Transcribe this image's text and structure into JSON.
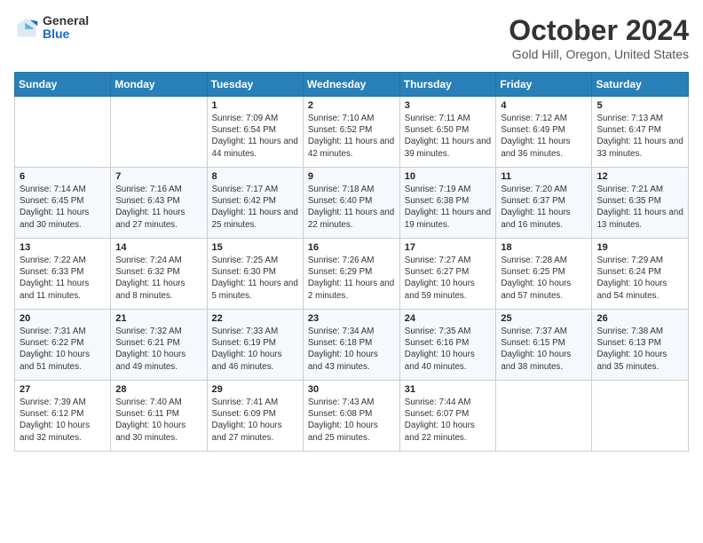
{
  "logo": {
    "general": "General",
    "blue": "Blue"
  },
  "title": "October 2024",
  "subtitle": "Gold Hill, Oregon, United States",
  "days_of_week": [
    "Sunday",
    "Monday",
    "Tuesday",
    "Wednesday",
    "Thursday",
    "Friday",
    "Saturday"
  ],
  "weeks": [
    [
      {
        "day": "",
        "info": ""
      },
      {
        "day": "",
        "info": ""
      },
      {
        "day": "1",
        "info": "Sunrise: 7:09 AM\nSunset: 6:54 PM\nDaylight: 11 hours and 44 minutes."
      },
      {
        "day": "2",
        "info": "Sunrise: 7:10 AM\nSunset: 6:52 PM\nDaylight: 11 hours and 42 minutes."
      },
      {
        "day": "3",
        "info": "Sunrise: 7:11 AM\nSunset: 6:50 PM\nDaylight: 11 hours and 39 minutes."
      },
      {
        "day": "4",
        "info": "Sunrise: 7:12 AM\nSunset: 6:49 PM\nDaylight: 11 hours and 36 minutes."
      },
      {
        "day": "5",
        "info": "Sunrise: 7:13 AM\nSunset: 6:47 PM\nDaylight: 11 hours and 33 minutes."
      }
    ],
    [
      {
        "day": "6",
        "info": "Sunrise: 7:14 AM\nSunset: 6:45 PM\nDaylight: 11 hours and 30 minutes."
      },
      {
        "day": "7",
        "info": "Sunrise: 7:16 AM\nSunset: 6:43 PM\nDaylight: 11 hours and 27 minutes."
      },
      {
        "day": "8",
        "info": "Sunrise: 7:17 AM\nSunset: 6:42 PM\nDaylight: 11 hours and 25 minutes."
      },
      {
        "day": "9",
        "info": "Sunrise: 7:18 AM\nSunset: 6:40 PM\nDaylight: 11 hours and 22 minutes."
      },
      {
        "day": "10",
        "info": "Sunrise: 7:19 AM\nSunset: 6:38 PM\nDaylight: 11 hours and 19 minutes."
      },
      {
        "day": "11",
        "info": "Sunrise: 7:20 AM\nSunset: 6:37 PM\nDaylight: 11 hours and 16 minutes."
      },
      {
        "day": "12",
        "info": "Sunrise: 7:21 AM\nSunset: 6:35 PM\nDaylight: 11 hours and 13 minutes."
      }
    ],
    [
      {
        "day": "13",
        "info": "Sunrise: 7:22 AM\nSunset: 6:33 PM\nDaylight: 11 hours and 11 minutes."
      },
      {
        "day": "14",
        "info": "Sunrise: 7:24 AM\nSunset: 6:32 PM\nDaylight: 11 hours and 8 minutes."
      },
      {
        "day": "15",
        "info": "Sunrise: 7:25 AM\nSunset: 6:30 PM\nDaylight: 11 hours and 5 minutes."
      },
      {
        "day": "16",
        "info": "Sunrise: 7:26 AM\nSunset: 6:29 PM\nDaylight: 11 hours and 2 minutes."
      },
      {
        "day": "17",
        "info": "Sunrise: 7:27 AM\nSunset: 6:27 PM\nDaylight: 10 hours and 59 minutes."
      },
      {
        "day": "18",
        "info": "Sunrise: 7:28 AM\nSunset: 6:25 PM\nDaylight: 10 hours and 57 minutes."
      },
      {
        "day": "19",
        "info": "Sunrise: 7:29 AM\nSunset: 6:24 PM\nDaylight: 10 hours and 54 minutes."
      }
    ],
    [
      {
        "day": "20",
        "info": "Sunrise: 7:31 AM\nSunset: 6:22 PM\nDaylight: 10 hours and 51 minutes."
      },
      {
        "day": "21",
        "info": "Sunrise: 7:32 AM\nSunset: 6:21 PM\nDaylight: 10 hours and 49 minutes."
      },
      {
        "day": "22",
        "info": "Sunrise: 7:33 AM\nSunset: 6:19 PM\nDaylight: 10 hours and 46 minutes."
      },
      {
        "day": "23",
        "info": "Sunrise: 7:34 AM\nSunset: 6:18 PM\nDaylight: 10 hours and 43 minutes."
      },
      {
        "day": "24",
        "info": "Sunrise: 7:35 AM\nSunset: 6:16 PM\nDaylight: 10 hours and 40 minutes."
      },
      {
        "day": "25",
        "info": "Sunrise: 7:37 AM\nSunset: 6:15 PM\nDaylight: 10 hours and 38 minutes."
      },
      {
        "day": "26",
        "info": "Sunrise: 7:38 AM\nSunset: 6:13 PM\nDaylight: 10 hours and 35 minutes."
      }
    ],
    [
      {
        "day": "27",
        "info": "Sunrise: 7:39 AM\nSunset: 6:12 PM\nDaylight: 10 hours and 32 minutes."
      },
      {
        "day": "28",
        "info": "Sunrise: 7:40 AM\nSunset: 6:11 PM\nDaylight: 10 hours and 30 minutes."
      },
      {
        "day": "29",
        "info": "Sunrise: 7:41 AM\nSunset: 6:09 PM\nDaylight: 10 hours and 27 minutes."
      },
      {
        "day": "30",
        "info": "Sunrise: 7:43 AM\nSunset: 6:08 PM\nDaylight: 10 hours and 25 minutes."
      },
      {
        "day": "31",
        "info": "Sunrise: 7:44 AM\nSunset: 6:07 PM\nDaylight: 10 hours and 22 minutes."
      },
      {
        "day": "",
        "info": ""
      },
      {
        "day": "",
        "info": ""
      }
    ]
  ]
}
